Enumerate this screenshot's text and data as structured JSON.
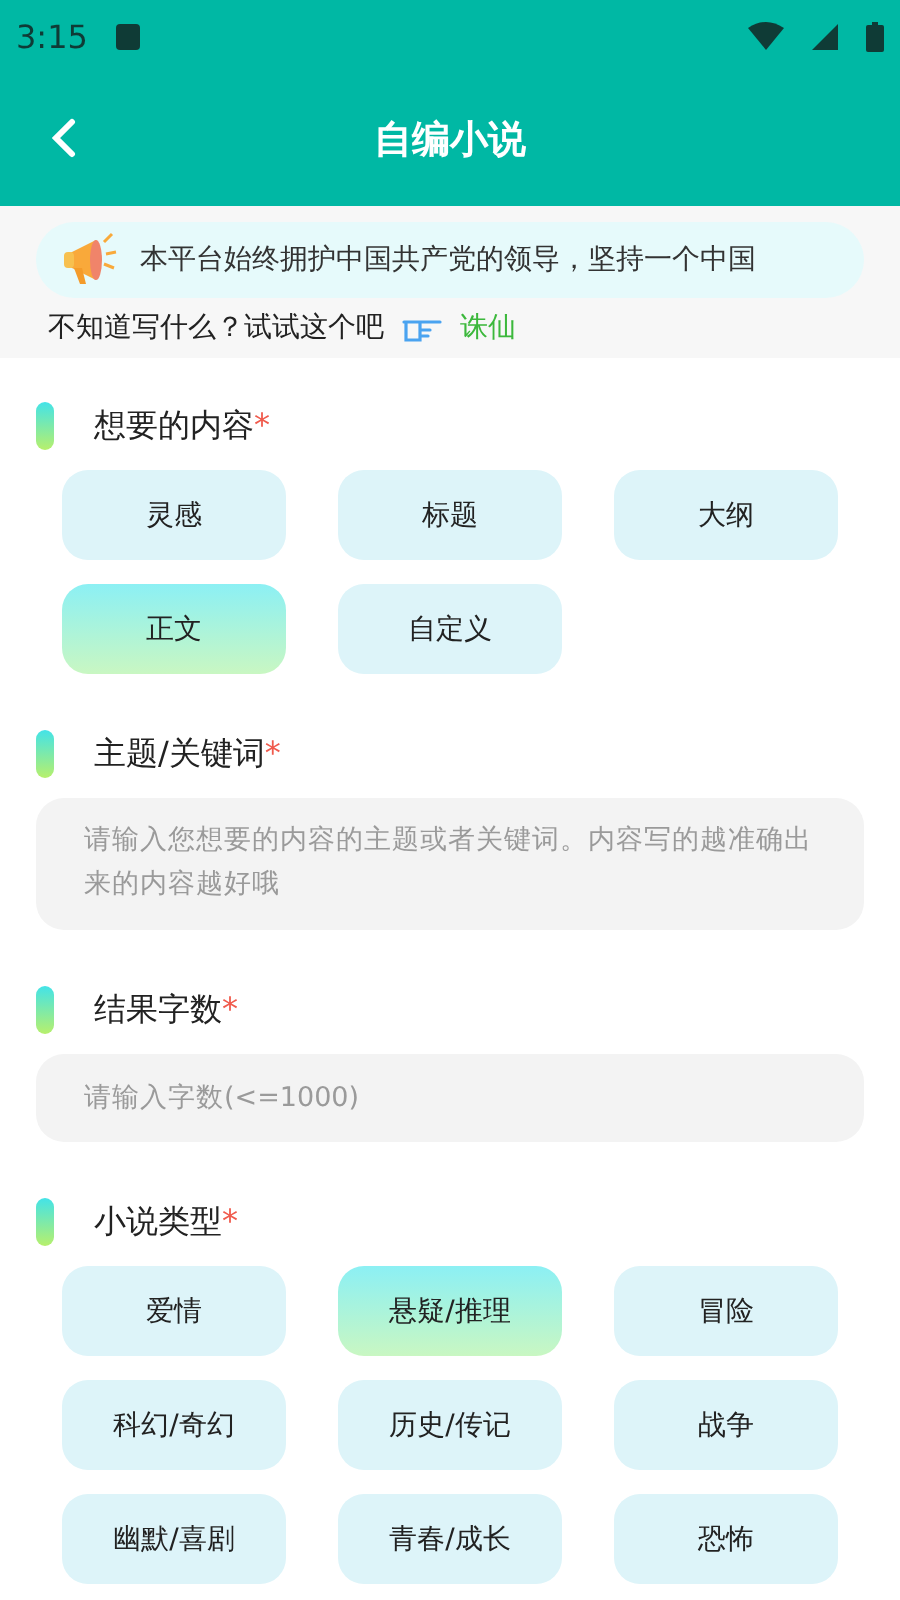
{
  "status_bar": {
    "time": "3:15"
  },
  "header": {
    "title": "自编小说"
  },
  "notice": {
    "text": "本平台始终拥护中国共产党的领导，坚持一个中国"
  },
  "hint": {
    "text": "不知道写什么？试试这个吧",
    "suggestion": "诛仙"
  },
  "sections": [
    {
      "kind": "chips",
      "title": "想要的内容",
      "required_mark": "*",
      "chips": [
        {
          "label": "灵感",
          "selected": false
        },
        {
          "label": "标题",
          "selected": false
        },
        {
          "label": "大纲",
          "selected": false
        },
        {
          "label": "正文",
          "selected": true
        },
        {
          "label": "自定义",
          "selected": false
        }
      ]
    },
    {
      "kind": "textarea",
      "title": "主题/关键词",
      "required_mark": "*",
      "placeholder": "请输入您想要的内容的主题或者关键词。内容写的越准确出来的内容越好哦"
    },
    {
      "kind": "input",
      "title": "结果字数",
      "required_mark": "*",
      "placeholder": "请输入字数(<=1000)"
    },
    {
      "kind": "chips",
      "title": "小说类型",
      "required_mark": "*",
      "chips": [
        {
          "label": "爱情",
          "selected": false
        },
        {
          "label": "悬疑/推理",
          "selected": true
        },
        {
          "label": "冒险",
          "selected": false
        },
        {
          "label": "科幻/奇幻",
          "selected": false
        },
        {
          "label": "历史/传记",
          "selected": false
        },
        {
          "label": "战争",
          "selected": false
        },
        {
          "label": "幽默/喜剧",
          "selected": false
        },
        {
          "label": "青春/成长",
          "selected": false
        },
        {
          "label": "恐怖",
          "selected": false
        }
      ]
    }
  ]
}
